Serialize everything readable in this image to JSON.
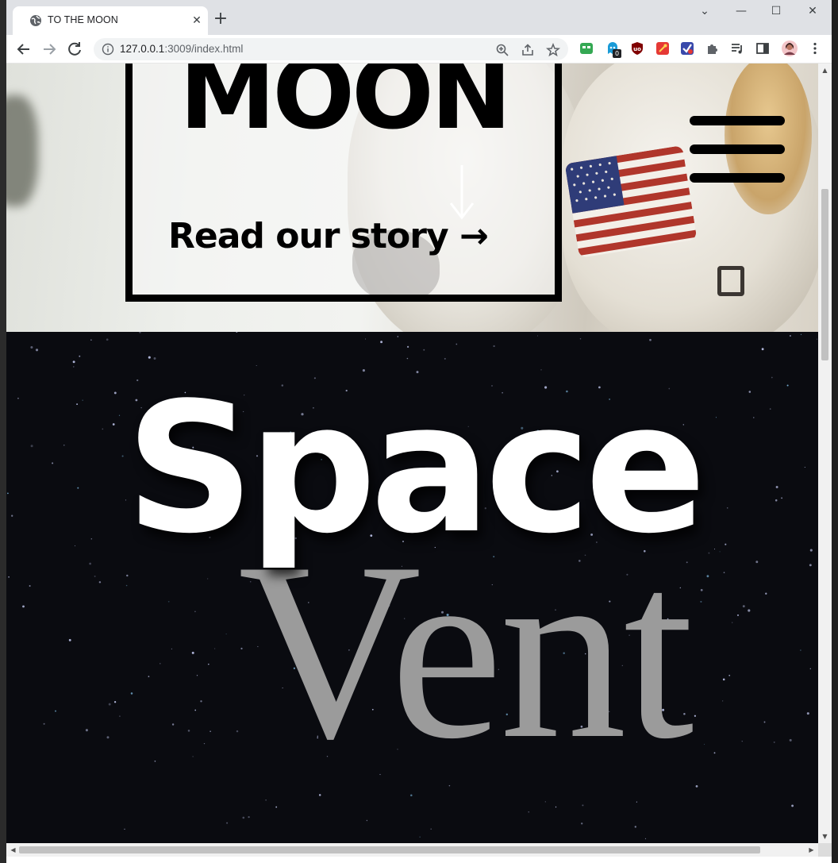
{
  "browser": {
    "tab_title": "TO THE MOON",
    "tab_close": "✕",
    "new_tab": "+",
    "url_host": "127.0.0.1",
    "url_rest": ":3009/index.html",
    "window_controls": [
      "⌄",
      "—",
      "☐",
      "✕"
    ]
  },
  "hero": {
    "title": "MOON",
    "down_arrow": "↓",
    "story_link": "Read our story →"
  },
  "space": {
    "headline": "Space",
    "background_word": "Vent"
  },
  "colors": {
    "chrome_bg": "#dfe1e5",
    "omnibox_bg": "#f1f3f4",
    "hero_text": "#000000",
    "space_bg": "#0a0b10",
    "space_word": "#ffffff",
    "venture_word": "#9b9b9b"
  },
  "icons": {
    "tab": "globe-icon",
    "nav": [
      "back-arrow-icon",
      "forward-arrow-icon",
      "reload-icon"
    ],
    "omnibox": [
      "info-icon",
      "zoom-icon",
      "share-icon",
      "star-icon"
    ],
    "extensions": [
      "ext-green-icon",
      "ext-blue-badge-icon",
      "ublock-icon",
      "ext-red-icon",
      "ext-check-icon",
      "puzzle-icon",
      "media-icon",
      "sidepanel-icon",
      "profile-avatar-icon",
      "menu-kebab-icon"
    ],
    "page_menu": "hamburger-menu-icon"
  },
  "extensions": {
    "blue_badge_count": "0"
  }
}
